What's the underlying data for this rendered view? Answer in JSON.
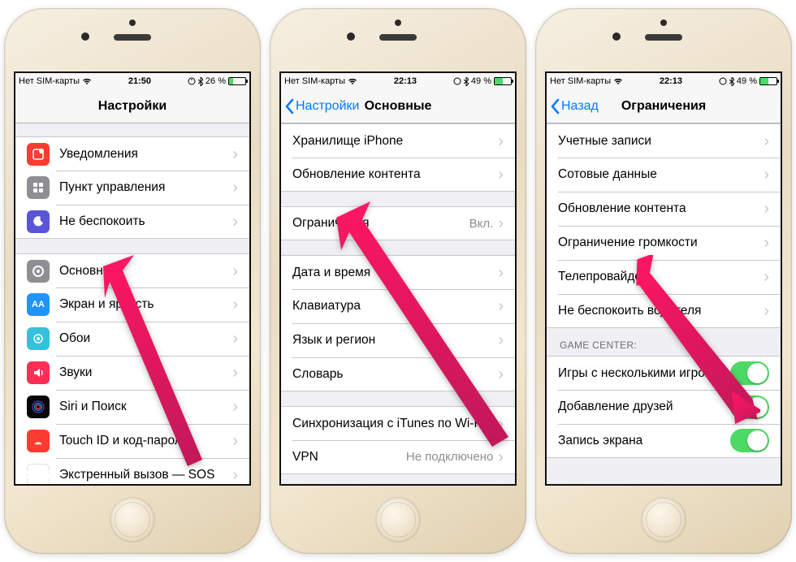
{
  "statusbar": {
    "carrier": "Нет SIM-карты",
    "time1": "21:50",
    "time2": "22:13",
    "battery1": "26 %",
    "battery2": "49 %"
  },
  "phone1": {
    "title": "Настройки",
    "rows": {
      "notifications": "Уведомления",
      "controlcenter": "Пункт управления",
      "dnd": "Не беспокоить",
      "general": "Основные",
      "display": "Экран и яркость",
      "wallpaper": "Обои",
      "sounds": "Звуки",
      "siri": "Siri и Поиск",
      "touchid": "Touch ID и код-пароль",
      "sos": "Экстренный вызов — SOS",
      "sos_icon": "SOS"
    }
  },
  "phone2": {
    "back": "Настройки",
    "title": "Основные",
    "rows": {
      "storage": "Хранилище iPhone",
      "refresh": "Обновление контента",
      "restrictions": "Ограничения",
      "restrictions_value": "Вкл.",
      "date": "Дата и время",
      "keyboard": "Клавиатура",
      "lang": "Язык и регион",
      "dict": "Словарь",
      "itunes": "Синхронизация с iTunes по Wi-Fi",
      "vpn": "VPN",
      "vpn_value": "Не подключено"
    }
  },
  "phone3": {
    "back": "Назад",
    "title": "Ограничения",
    "rows": {
      "accounts": "Учетные записи",
      "cellular": "Сотовые данные",
      "refresh": "Обновление контента",
      "volume": "Ограничение громкости",
      "tv": "Телепровайдер",
      "dnd_driving": "Не беспокоить водителя"
    },
    "section": "GAME CENTER:",
    "gc": {
      "multiplayer": "Игры с несколькими игрока...",
      "friends": "Добавление друзей",
      "record": "Запись экрана"
    }
  }
}
